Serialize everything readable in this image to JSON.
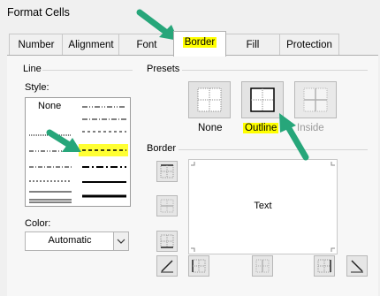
{
  "window": {
    "title": "Format Cells"
  },
  "tabs": [
    {
      "label": "Number"
    },
    {
      "label": "Alignment"
    },
    {
      "label": "Font"
    },
    {
      "label": "Border"
    },
    {
      "label": "Fill"
    },
    {
      "label": "Protection"
    }
  ],
  "active_tab": "Border",
  "line_group": {
    "title": "Line",
    "style_label": "Style:",
    "none_label": "None",
    "color_label": "Color:",
    "color_value": "Automatic"
  },
  "presets_group": {
    "title": "Presets",
    "none_label": "None",
    "outline_label": "Outline",
    "inside_label": "Inside"
  },
  "border_group": {
    "title": "Border",
    "preview_text": "Text"
  },
  "colors": {
    "highlight": "#ffff00",
    "arrow": "#27a67a"
  }
}
